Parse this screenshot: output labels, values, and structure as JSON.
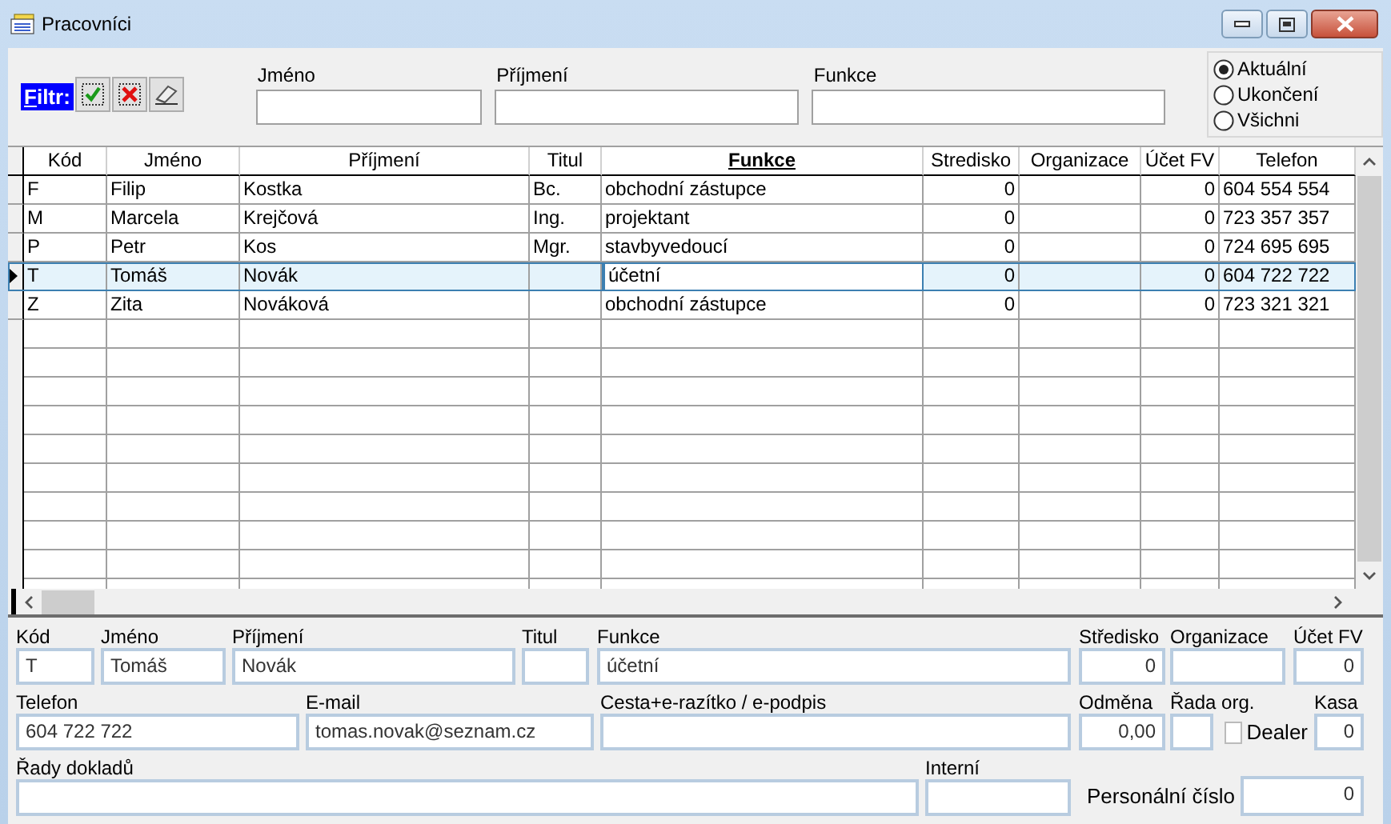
{
  "window": {
    "title": "Pracovníci"
  },
  "filter": {
    "label": "Filtr:",
    "fields": [
      {
        "label": "Jméno"
      },
      {
        "label": "Příjmení"
      },
      {
        "label": "Funkce"
      }
    ],
    "radios": [
      {
        "label": "Aktuální",
        "selected": true
      },
      {
        "label": "Ukončení",
        "selected": false
      },
      {
        "label": "Všichni",
        "selected": false
      }
    ]
  },
  "table": {
    "columns": [
      {
        "label": "Kód",
        "kind": "text",
        "sorted": false
      },
      {
        "label": "Jméno",
        "kind": "text",
        "sorted": false
      },
      {
        "label": "Příjmení",
        "kind": "text",
        "sorted": false
      },
      {
        "label": "Titul",
        "kind": "text",
        "sorted": false
      },
      {
        "label": "Funkce",
        "kind": "text",
        "sorted": true
      },
      {
        "label": "Stredisko",
        "kind": "number",
        "sorted": false
      },
      {
        "label": "Organizace",
        "kind": "text",
        "sorted": false
      },
      {
        "label": "Účet FV",
        "kind": "number",
        "sorted": false
      },
      {
        "label": "Telefon",
        "kind": "text",
        "sorted": false
      }
    ],
    "rows": [
      {
        "selected": false,
        "cells": [
          "F",
          "Filip",
          "Kostka",
          "Bc.",
          "obchodní zástupce",
          "0",
          "",
          "0",
          "604 554 554"
        ]
      },
      {
        "selected": false,
        "cells": [
          "M",
          "Marcela",
          "Krejčová",
          "Ing.",
          "projektant",
          "0",
          "",
          "0",
          "723 357 357"
        ]
      },
      {
        "selected": false,
        "cells": [
          "P",
          "Petr",
          "Kos",
          "Mgr.",
          "stavbyvedoucí",
          "0",
          "",
          "0",
          "724 695 695"
        ]
      },
      {
        "selected": true,
        "cells": [
          "T",
          "Tomáš",
          "Novák",
          "",
          "účetní",
          "0",
          "",
          "0",
          "604 722 722"
        ]
      },
      {
        "selected": false,
        "cells": [
          "Z",
          "Zita",
          "Nováková",
          "",
          "obchodní zástupce",
          "0",
          "",
          "0",
          "723 321 321"
        ]
      }
    ]
  },
  "detail": {
    "fields": [
      {
        "kind": "text",
        "label": "Kód",
        "value": "T"
      },
      {
        "kind": "text",
        "label": "Jméno",
        "value": "Tomáš"
      },
      {
        "kind": "text",
        "label": "Příjmení",
        "value": "Novák"
      },
      {
        "kind": "text",
        "label": "Titul"
      },
      {
        "kind": "text",
        "label": "Funkce",
        "value": "účetní"
      },
      {
        "kind": "number",
        "label": "Středisko",
        "value": "0"
      },
      {
        "kind": "text",
        "label": "Organizace"
      },
      {
        "kind": "number",
        "label": "Účet FV",
        "value": "0"
      },
      {
        "kind": "text",
        "label": "Telefon",
        "value": "604 722 722"
      },
      {
        "kind": "text",
        "label": "E-mail",
        "value": "tomas.novak@seznam.cz"
      },
      {
        "kind": "text",
        "label": "Cesta+e-razítko / e-podpis"
      },
      {
        "kind": "number",
        "label": "Odměna",
        "value": "0,00"
      },
      {
        "kind": "text",
        "label": "Řada org."
      },
      {
        "kind": "checkbox",
        "label": "Dealer",
        "checked": false
      },
      {
        "kind": "number",
        "label": "Kasa",
        "value": "0"
      },
      {
        "kind": "text",
        "label": "Řady dokladů"
      },
      {
        "kind": "text",
        "label": "Interní"
      },
      {
        "kind": "inline",
        "label": "Personální číslo",
        "value": "0"
      }
    ]
  }
}
